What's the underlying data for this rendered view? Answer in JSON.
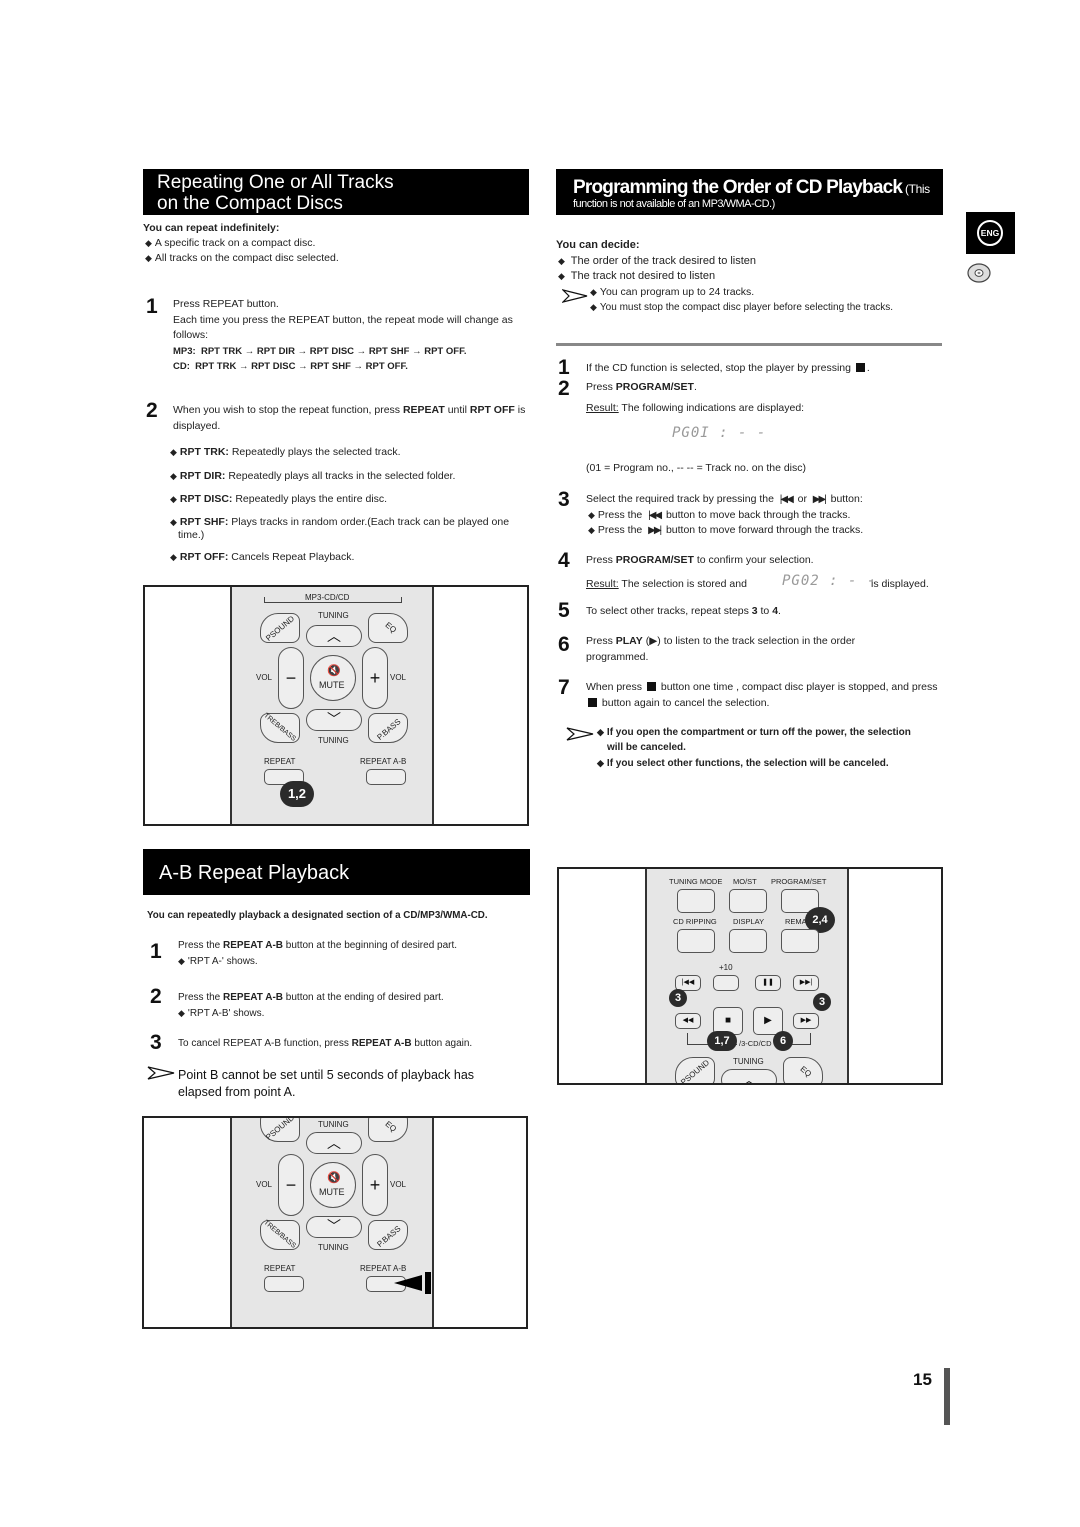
{
  "left": {
    "repeat_section": {
      "title_line1": "Repeating One or All Tracks",
      "title_line2": "on the Compact Discs",
      "intro_heading": "You can repeat indefinitely:",
      "intro_items": [
        "A specific track on a compact disc.",
        "All tracks on the compact disc selected."
      ],
      "steps": [
        {
          "num": "1",
          "line1": "Press REPEAT button.",
          "line2": "Each time you press the REPEAT button, the repeat mode will change as follows:",
          "mp3_label": "MP3:",
          "mp3_sequence": "RPT TRK → RPT DIR  → RPT DISC  → RPT SHF → RPT OFF.",
          "cd_label": "CD:",
          "cd_sequence": "RPT TRK  → RPT DISC → RPT SHF → RPT OFF."
        },
        {
          "num": "2",
          "pre": "When you wish to stop the repeat function, press ",
          "bold1": "REPEAT",
          "mid": " until ",
          "bold2": "RPT OFF",
          "post": " is displayed."
        }
      ],
      "modes": [
        {
          "term": "RPT TRK:",
          "desc": "Repeatedly plays the selected track."
        },
        {
          "term": "RPT DIR:",
          "desc": "Repeatedly plays all tracks in the selected folder."
        },
        {
          "term": "RPT DISC:",
          "desc": "Repeatedly plays the entire disc."
        },
        {
          "term": "RPT SHF:",
          "desc": "Plays tracks in random order.(Each track can be played one time.)"
        },
        {
          "term": "RPT OFF:",
          "desc": "Cancels Repeat Playback."
        }
      ],
      "remote": {
        "top_label": "MP3-CD/CD",
        "psound": "PSOUND",
        "tuning_up": "TUNING",
        "eq": "EQ",
        "vol_left": "VOL",
        "vol_right": "VOL",
        "minus": "−",
        "plus": "+",
        "mute": "MUTE",
        "treb_bass": "TREB/BASS",
        "tuning_down": "TUNING",
        "pbass": "P.BASS",
        "repeat": "REPEAT",
        "repeat_ab": "REPEAT A-B",
        "callout": "1,2"
      }
    },
    "ab_section": {
      "title": "A-B Repeat Playback",
      "intro": "You can repeatedly playback a designated section of a CD/MP3/WMA-CD.",
      "steps": [
        {
          "num": "1",
          "pre": "Press the ",
          "bold": "REPEAT A-B",
          "post": " button at the beginning of desired part.",
          "sub": "'RPT A-' shows."
        },
        {
          "num": "2",
          "pre": "Press the ",
          "bold": "REPEAT A-B",
          "post": " button at the ending of desired part.",
          "sub": "'RPT A-B' shows."
        },
        {
          "num": "3",
          "pre": "To cancel REPEAT A-B function, press ",
          "bold": "REPEAT A-B",
          "post": " button again."
        }
      ],
      "note": "Point B cannot be set until 5 seconds of playback has elapsed from point A.",
      "remote": {
        "psound": "PSOUND",
        "tuning_up": "TUNING",
        "eq": "EQ",
        "vol_left": "VOL",
        "vol_right": "VOL",
        "minus": "−",
        "plus": "+",
        "mute": "MUTE",
        "treb_bass": "TREB/BASS",
        "tuning_down": "TUNING",
        "pbass": "P.BASS",
        "repeat": "REPEAT",
        "repeat_ab": "REPEAT A-B"
      }
    }
  },
  "right": {
    "program_section": {
      "title_main": "Programming the Order of CD Playback",
      "title_paren": " (This",
      "title_sub": "function is not available of an MP3/WMA-CD.)",
      "decide_heading": "You can decide:",
      "decide_items": [
        "The order of the track desired to listen",
        "The track not desired to listen"
      ],
      "notes": [
        "You can program up to 24 tracks.",
        "You must stop the compact disc player before selecting the tracks."
      ],
      "steps": {
        "s1": {
          "num": "1",
          "text": "If the CD function is selected, stop the player by pressing",
          "post": "."
        },
        "s2": {
          "num": "2",
          "pre": "Press ",
          "bold": "PROGRAM/SET",
          "post": ".",
          "result_label": "Result:",
          "result_text": " The following indications are displayed:",
          "display": "PG0I : - -",
          "legend": "(01 = Program no.,   -- -- = Track no. on the disc)"
        },
        "s3": {
          "num": "3",
          "text_pre": "Select the required track by pressing the",
          "text_or": "or",
          "text_post": "button:",
          "sub1_pre": "Press the",
          "sub1_post": "button to move back through the tracks.",
          "sub2_pre": "Press the",
          "sub2_post": "button to move forward through the tracks."
        },
        "s4": {
          "num": "4",
          "pre": "Press ",
          "bold": "PROGRAM/SET",
          "post": " to confirm your selection.",
          "result_label": "Result:",
          "result_text": " The selection is stored and",
          "display": "PG02 : - -",
          "result_post": "is displayed."
        },
        "s5": {
          "num": "5",
          "pre": "To select other tracks, repeat steps ",
          "b1": "3",
          "mid": " to ",
          "b2": "4",
          "post": "."
        },
        "s6": {
          "num": "6",
          "pre": "Press ",
          "bold": "PLAY",
          "post": " (▶) to listen to the track selection in the order programmed."
        },
        "s7": {
          "num": "7",
          "pre": "When press",
          "mid": "button one time , compact disc player is stopped, and press",
          "post": "button again to cancel the selection."
        }
      },
      "cancel_notes": [
        "If you open the compartment or turn off the power, the selection will be canceled.",
        "If you select other functions, the selection will be canceled."
      ],
      "remote": {
        "tuning_mode": "TUNING MODE",
        "mo_st": "MO/ST",
        "program_set": "PROGRAM/SET",
        "cd_ripping": "CD RIPPING",
        "display": "DISPLAY",
        "remain": "REMA",
        "plus10": "+10",
        "mp3cd": "/3-CD/CD",
        "tuning": "TUNING",
        "psound": "PSOUND",
        "eq": "EQ",
        "callout_24": "2,4",
        "callout_3a": "3",
        "callout_3b": "3",
        "callout_17": "1,7",
        "callout_6": "6"
      }
    }
  },
  "side": {
    "language_badge": "ENG",
    "disc_icon": "cd-disc-icon"
  },
  "footer": {
    "page_number": "15"
  }
}
